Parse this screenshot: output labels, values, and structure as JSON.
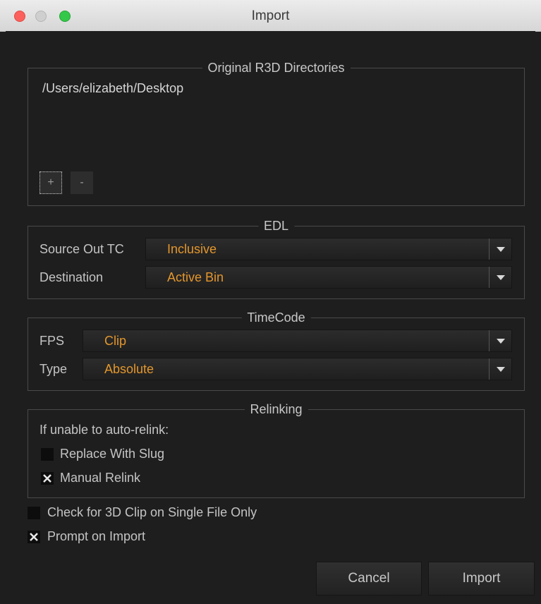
{
  "window": {
    "title": "Import"
  },
  "directories": {
    "legend": "Original R3D Directories",
    "paths": [
      "/Users/elizabeth/Desktop"
    ],
    "add_label": "+",
    "remove_label": "-"
  },
  "edl": {
    "legend": "EDL",
    "source_out_tc": {
      "label": "Source Out TC",
      "value": "Inclusive"
    },
    "destination": {
      "label": "Destination",
      "value": "Active Bin"
    }
  },
  "timecode": {
    "legend": "TimeCode",
    "fps": {
      "label": "FPS",
      "value": "Clip"
    },
    "type": {
      "label": "Type",
      "value": "Absolute"
    }
  },
  "relinking": {
    "legend": "Relinking",
    "note": "If unable to auto-relink:",
    "replace_with_slug": {
      "label": "Replace With Slug",
      "checked": false
    },
    "manual_relink": {
      "label": "Manual Relink",
      "checked": true
    }
  },
  "options": {
    "check_3d": {
      "label": "Check for 3D Clip on Single File Only",
      "checked": false
    },
    "prompt_on_import": {
      "label": "Prompt on Import",
      "checked": true
    }
  },
  "buttons": {
    "cancel": "Cancel",
    "import": "Import"
  },
  "colors": {
    "accent": "#e3962c",
    "background": "#1e1e1e"
  }
}
